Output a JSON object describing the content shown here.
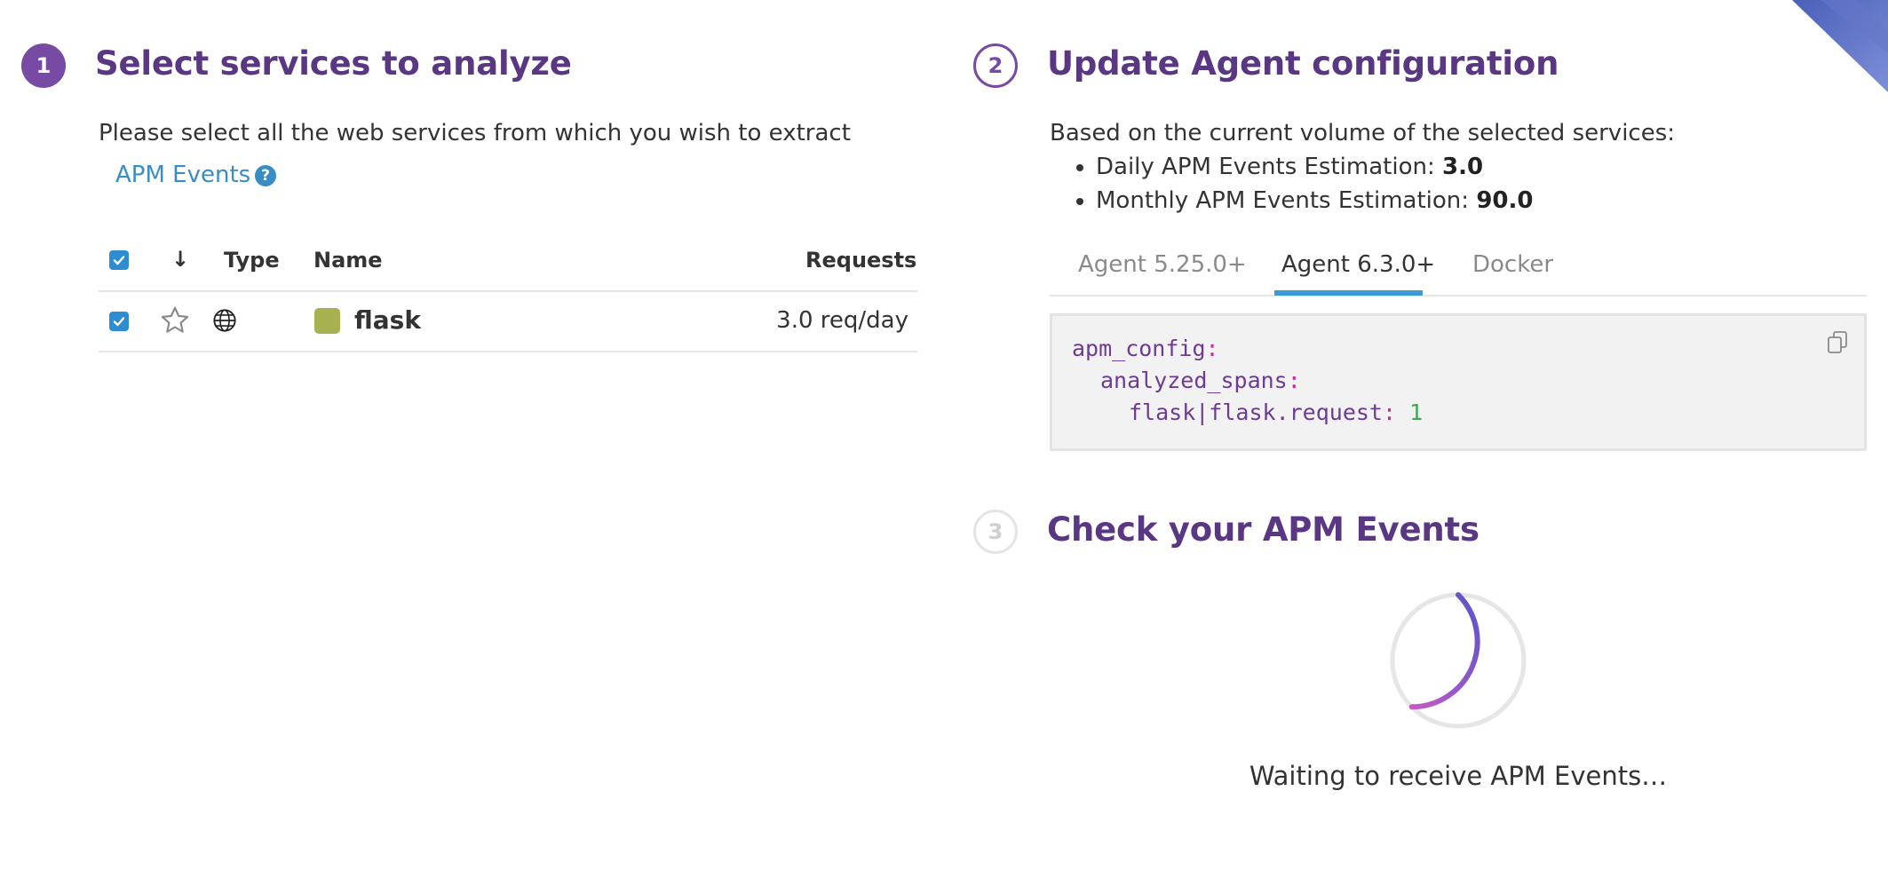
{
  "step1": {
    "number": "1",
    "title": "Select services to analyze",
    "description": "Please select all the web services from which you wish to extract",
    "link_label": "APM Events",
    "help_glyph": "?",
    "table": {
      "sort_arrow": "↓",
      "headers": {
        "type": "Type",
        "name": "Name",
        "requests": "Requests"
      },
      "rows": [
        {
          "name": "flask",
          "requests": "3.0 req/day",
          "service_color": "#a8b14f",
          "checked": true,
          "type_icon": "globe-icon"
        }
      ]
    }
  },
  "step2": {
    "number": "2",
    "title": "Update Agent configuration",
    "intro": "Based on the current volume of the selected services:",
    "estimates": [
      {
        "label": "Daily APM Events Estimation: ",
        "value": "3.0"
      },
      {
        "label": "Monthly APM Events Estimation: ",
        "value": "90.0"
      }
    ],
    "tabs": [
      {
        "label": "Agent 5.25.0+",
        "active": false
      },
      {
        "label": "Agent 6.3.0+",
        "active": true
      },
      {
        "label": "Docker",
        "active": false
      }
    ],
    "code": {
      "line1_key": "apm_config",
      "line2_key": "analyzed_spans",
      "line3_key": "flask|flask.request",
      "line3_value": "1",
      "colon": ":"
    }
  },
  "step3": {
    "number": "3",
    "title": "Check your APM Events",
    "waiting": "Waiting to receive APM Events…"
  },
  "colors": {
    "accent": "#774aa4",
    "heading": "#5a3782",
    "link": "#3a8dc4",
    "tab_active": "#3a9bd5"
  }
}
